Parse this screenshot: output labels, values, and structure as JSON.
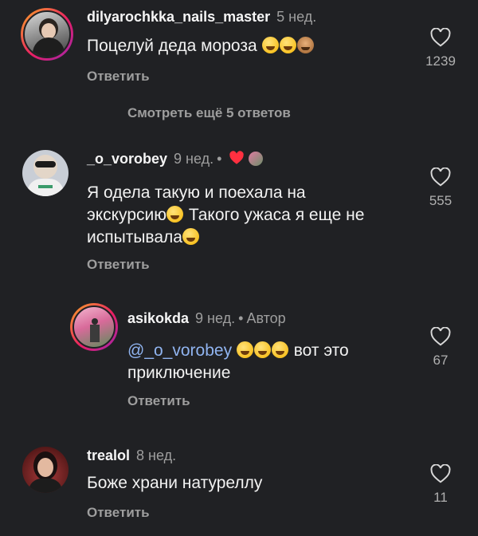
{
  "comments": [
    {
      "username": "dilyarochkka_nails_master",
      "time": "5 нед.",
      "text": "Поцелуй деда мороза",
      "reply": "Ответить",
      "likes": "1239",
      "more_replies": "Смотреть ещё 5 ответов"
    },
    {
      "username": "_o_vorobey",
      "time": "9 нед.",
      "text_line1": "Я одела такую и поехала на",
      "text_line2a": "экскурсию",
      "text_line2b": " Такого ужаса я еще не",
      "text_line3": "испытывала",
      "reply": "Ответить",
      "likes": "555"
    },
    {
      "username": "asikokda",
      "time": "9 нед.",
      "author_label": "Автор",
      "mention": "@_o_vorobey",
      "text_after": " вот это",
      "text_line2": "приключение",
      "reply": "Ответить",
      "likes": "67"
    },
    {
      "username": "trealol",
      "time": "8 нед.",
      "text": "Боже храни натуреллу",
      "reply": "Ответить",
      "likes": "11"
    }
  ],
  "icons": {
    "like": "heart-outline-icon",
    "creator_like": "heart-filled-icon",
    "emoji_laugh": "rofl-emoji",
    "emoji_grin": "grinning-emoji",
    "emoji_monkey": "see-no-evil-monkey-emoji"
  },
  "colors": {
    "background": "#202124",
    "mention": "#90b4f0",
    "heart_red": "#ff3040"
  }
}
